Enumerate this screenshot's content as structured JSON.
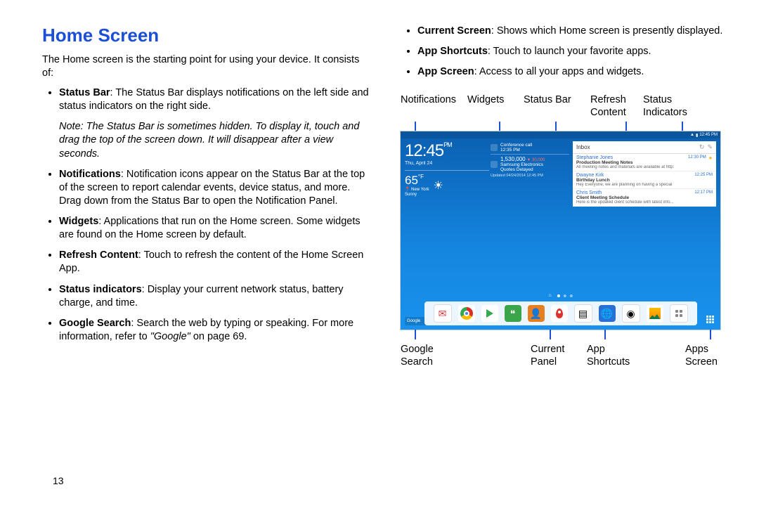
{
  "heading": "Home Screen",
  "intro": "The Home screen is the starting point for using your device. It consists of:",
  "page_number": "13",
  "left_bullets": [
    {
      "term": "Status Bar",
      "text": ": The Status Bar displays notifications on the left side and status indicators on the right side."
    },
    {
      "note": "Note: The Status Bar is sometimes hidden. To display it, touch and drag the top of the screen down. It will disappear after a view seconds."
    },
    {
      "term": "Notifications",
      "text": ": Notification icons appear on the Status Bar at the top of the screen to report calendar events, device status, and more. Drag down from the Status Bar to open the Notification Panel."
    },
    {
      "term": "Widgets",
      "text": ": Applications that run on the Home screen. Some widgets are found on the Home screen by default."
    },
    {
      "term": "Refresh Content",
      "text": ": Touch to refresh the content of the Home Screen App."
    },
    {
      "term": "Status indicators",
      "text": ": Display your current network status, battery charge, and time."
    },
    {
      "term": "Google Search",
      "text": ": Search the web by typing or speaking. For more information, refer to ",
      "ref": "\"Google\"",
      "tail": " on page 69."
    }
  ],
  "right_bullets": [
    {
      "term": "Current Screen",
      "text": ": Shows which Home screen is presently displayed."
    },
    {
      "term": "App Shortcuts",
      "text": ": Touch to launch your favorite apps."
    },
    {
      "term": "App Screen",
      "text": ": Access to all your apps and widgets."
    }
  ],
  "labels_top": {
    "notifications": "Notifications",
    "widgets": "Widgets",
    "statusbar": "Status Bar",
    "refresh": "Refresh\nContent",
    "status": "Status\nIndicators"
  },
  "labels_bottom": {
    "google": "Google\nSearch",
    "current": "Current\nPanel",
    "shortcuts": "App\nShortcuts",
    "apps": "Apps\nScreen"
  },
  "device": {
    "status_time": "12:45 PM",
    "clock_time": "12:45",
    "clock_pm": "PM",
    "clock_date": "Thu, April 24",
    "weather_temp": "65",
    "weather_unit": "°F",
    "weather_city": "New York",
    "weather_cond": "Sunny",
    "conf_title": "Conference call",
    "conf_time": "12:35 PM",
    "stock_val": "1,530,000",
    "stock_delta": "▼ 30,000",
    "stock_name": "Samsung Electronics",
    "stock_sub": "Quotes Delayed",
    "stock_upd": "Updated 04/24/2014 12:45 PM",
    "inbox_title": "Inbox",
    "messages": [
      {
        "from": "Stephanie Jones",
        "subj": "Production Meeting Notes",
        "prev": "All meeting notes and materials are available at http:",
        "time": "12:30 PM",
        "star": true
      },
      {
        "from": "Dwayne Kirk",
        "subj": "Birthday Lunch",
        "prev": "Hey Everyone, we are planning on having a special",
        "time": "12:25 PM",
        "star": false
      },
      {
        "from": "Chris Smith",
        "subj": "Client Meeting Schedule",
        "prev": "Here is the updated client schedule with latest info...",
        "time": "12:17 PM",
        "star": false
      }
    ],
    "google_label": "Google"
  }
}
